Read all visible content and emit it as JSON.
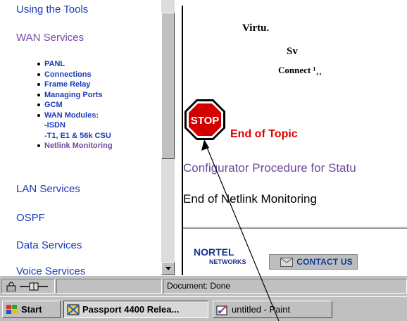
{
  "nav": {
    "sections_top": [
      {
        "label": "Using the Tools"
      },
      {
        "label": "WAN Services"
      }
    ],
    "wan_subitems": [
      {
        "label": "PANL",
        "bullet": true
      },
      {
        "label": "Connections",
        "bullet": true
      },
      {
        "label": "Frame Relay",
        "bullet": true
      },
      {
        "label": "Managing Ports",
        "bullet": true
      },
      {
        "label": "GCM",
        "bullet": true
      },
      {
        "label": "WAN Modules:",
        "bullet": true
      },
      {
        "label": "-ISDN",
        "bullet": false
      },
      {
        "label": "-T1, E1 & 56k CSU",
        "bullet": false
      },
      {
        "label": "Netlink Monitoring",
        "bullet": true
      }
    ],
    "sections_bottom": [
      {
        "label": "LAN Services"
      },
      {
        "label": "OSPF"
      },
      {
        "label": "Data Services"
      },
      {
        "label": "Voice Services"
      }
    ]
  },
  "content": {
    "title_line1": "Virtu.",
    "title_line2": "Sv",
    "title_line3": "Connect ¹¸¸",
    "stop_sign_text": "STOP",
    "end_of_topic": "End of Topic",
    "procedure_link": "Configurator Procedure for Statu",
    "end_text": "End of Netlink Monitoring",
    "nortel_logo_top": "NORTEL",
    "nortel_logo_bottom": "NETWORKS",
    "contact_button": "CONTACT US"
  },
  "status_bar": {
    "text": "Document: Done"
  },
  "taskbar": {
    "start_label": "Start",
    "tasks": [
      {
        "label": "Passport 4400 Relea..."
      },
      {
        "label": "untitled - Paint"
      }
    ]
  },
  "colors": {
    "link": "#1a3bb8",
    "visited": "#7a4aa6",
    "stop_red": "#e00000",
    "chrome": "#c0c0c0"
  }
}
